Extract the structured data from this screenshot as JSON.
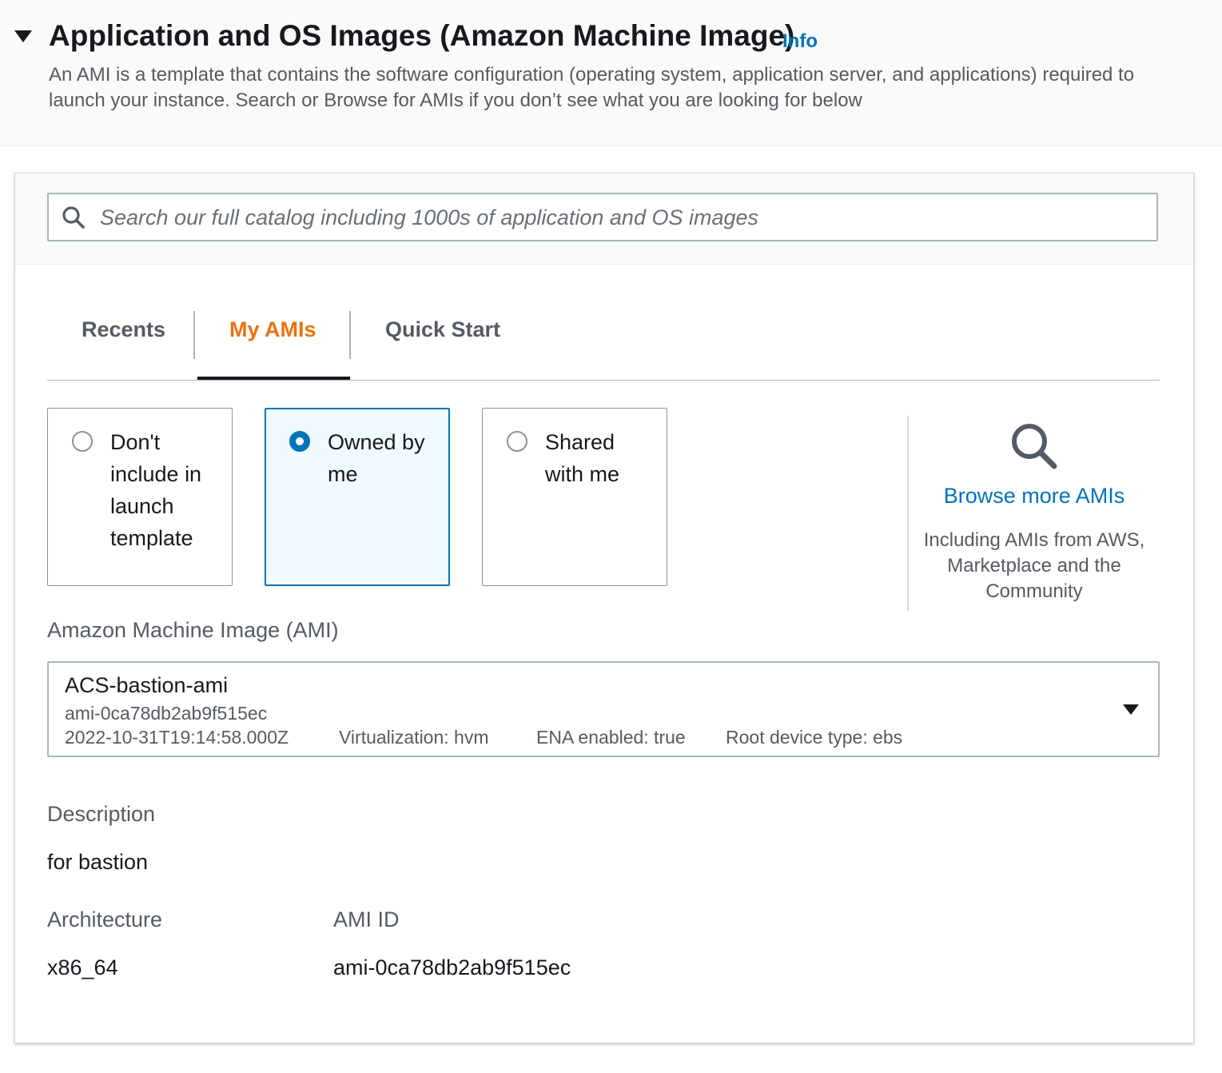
{
  "section": {
    "title": "Application and OS Images (Amazon Machine Image)",
    "info_label": "Info",
    "description": "An AMI is a template that contains the software configuration (operating system, application server, and applications) required to launch your instance. Search or Browse for AMIs if you don’t see what you are looking for below"
  },
  "search": {
    "placeholder": "Search our full catalog including 1000s of application and OS images",
    "value": ""
  },
  "tabs": [
    {
      "label": "Recents",
      "active": false
    },
    {
      "label": "My AMIs",
      "active": true
    },
    {
      "label": "Quick Start",
      "active": false
    }
  ],
  "ownership_options": [
    {
      "label": "Don't include in launch template",
      "selected": false
    },
    {
      "label": "Owned by me",
      "selected": true
    },
    {
      "label": "Shared with me",
      "selected": false
    }
  ],
  "browse": {
    "link_label": "Browse more AMIs",
    "subtitle": "Including AMIs from AWS, Marketplace and the Community"
  },
  "ami_select": {
    "label": "Amazon Machine Image (AMI)",
    "name": "ACS-bastion-ami",
    "id": "ami-0ca78db2ab9f515ec",
    "created": "2022-10-31T19:14:58.000Z",
    "virtualization": "Virtualization: hvm",
    "ena": "ENA enabled: true",
    "root_device": "Root device type: ebs"
  },
  "details": {
    "description_label": "Description",
    "description_value": "for bastion",
    "architecture_label": "Architecture",
    "architecture_value": "x86_64",
    "ami_id_label": "AMI ID",
    "ami_id_value": "ami-0ca78db2ab9f515ec"
  },
  "colors": {
    "accent": "#0073bb",
    "active_tab": "#ec7211",
    "text": "#16191f",
    "muted": "#545b64"
  }
}
